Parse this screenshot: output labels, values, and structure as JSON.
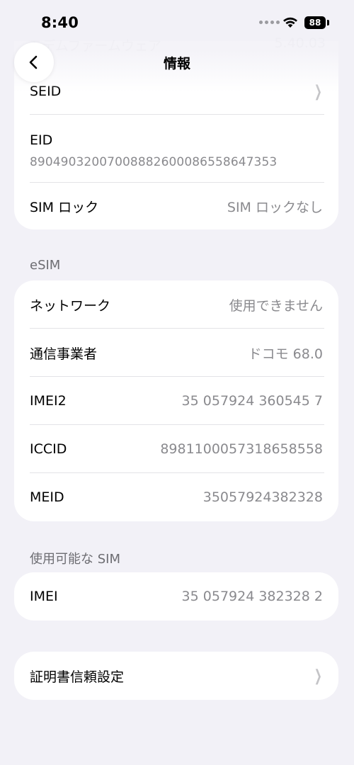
{
  "status_bar": {
    "time": "8:40",
    "battery": "88"
  },
  "background_header": {
    "label": "モデムファームウェア",
    "value": "5.40.03"
  },
  "nav": {
    "title": "情報"
  },
  "top_card": {
    "seid_label": "SEID",
    "eid_label": "EID",
    "eid_value": "89049032007008882600086558647353",
    "sim_lock_label": "SIM ロック",
    "sim_lock_value": "SIM ロックなし"
  },
  "esim_section": {
    "header": "eSIM",
    "rows": [
      {
        "label": "ネットワーク",
        "value": "使用できません"
      },
      {
        "label": "通信事業者",
        "value": "ドコモ 68.0"
      },
      {
        "label": "IMEI2",
        "value": "35 057924 360545 7"
      },
      {
        "label": "ICCID",
        "value": "8981100057318658558"
      },
      {
        "label": "MEID",
        "value": "35057924382328"
      }
    ]
  },
  "available_sim_section": {
    "header": "使用可能な SIM",
    "rows": [
      {
        "label": "IMEI",
        "value": "35 057924 382328 2"
      }
    ]
  },
  "certificate": {
    "label": "証明書信頼設定"
  },
  "icons": {
    "back": "chevron-left-icon",
    "chevron": "chevron-right-icon",
    "wifi": "wifi-icon",
    "battery": "battery-icon"
  }
}
